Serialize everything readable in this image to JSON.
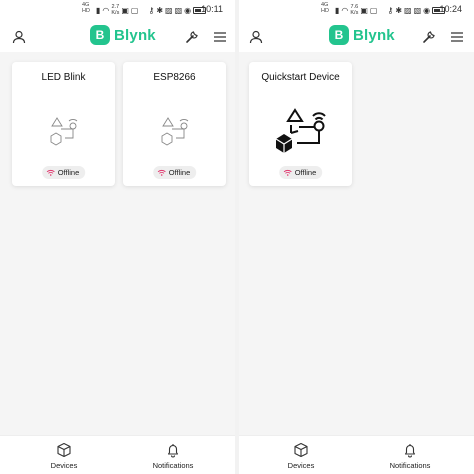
{
  "left": {
    "statusbar": {
      "net_a": "4G",
      "net_b": "HD",
      "speed": "2.7",
      "speed_unit": "K/s",
      "time": "10:11"
    },
    "brand": {
      "badge": "B",
      "name": "Blynk"
    },
    "devices": [
      {
        "name": "LED Blink",
        "status": "Offline"
      },
      {
        "name": "ESP8266",
        "status": "Offline"
      }
    ],
    "nav": {
      "devices": "Devices",
      "notifications": "Notifications"
    }
  },
  "right": {
    "statusbar": {
      "net_a": "4G",
      "net_b": "HD",
      "speed": "7.6",
      "speed_unit": "K/s",
      "time": "10:24"
    },
    "brand": {
      "badge": "B",
      "name": "Blynk"
    },
    "devices": [
      {
        "name": "Quickstart Device",
        "status": "Offline"
      }
    ],
    "nav": {
      "devices": "Devices",
      "notifications": "Notifications"
    }
  },
  "colors": {
    "brand": "#23c48e",
    "offline_icon": "#e0336b",
    "card_bg": "#ffffff",
    "content_bg": "#f5f5f5"
  }
}
